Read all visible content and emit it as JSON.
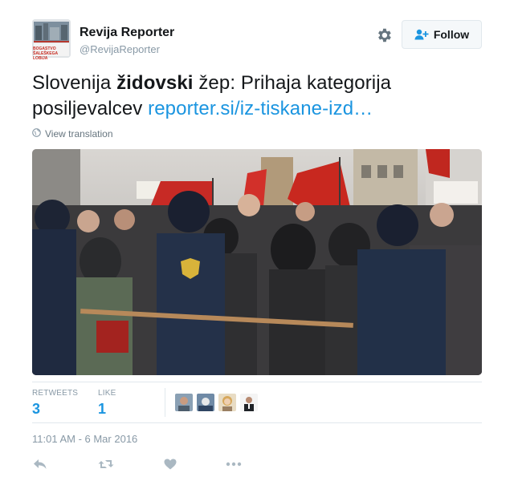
{
  "user": {
    "name": "Revija Reporter",
    "handle": "@RevijaReporter",
    "avatar_caption_lines": [
      "BOGASTVO",
      "ŠALEŠKEGA LOBIJA"
    ]
  },
  "follow_button": {
    "label": "Follow"
  },
  "tweet": {
    "text_before": "Slovenija ",
    "text_bold": "židovski",
    "text_after": " žep: Prihaja kategorija posiljevalcev ",
    "link_text": "reporter.si/iz-tiskane-izd…"
  },
  "translate": {
    "label": "View translation"
  },
  "stats": {
    "retweets_label": "RETWEETS",
    "retweets_count": "3",
    "likes_label": "LIKE",
    "likes_count": "1"
  },
  "timestamp": "11:01 AM - 6 Mar 2016",
  "icons": {
    "settings": "gear-icon",
    "follow": "user-plus-icon",
    "translate": "globe-icon",
    "reply": "reply-icon",
    "retweet": "retweet-icon",
    "like": "heart-icon",
    "more": "more-icon"
  },
  "colors": {
    "link": "#1b95e0",
    "muted": "#8899a6",
    "border": "#e1e8ed"
  }
}
